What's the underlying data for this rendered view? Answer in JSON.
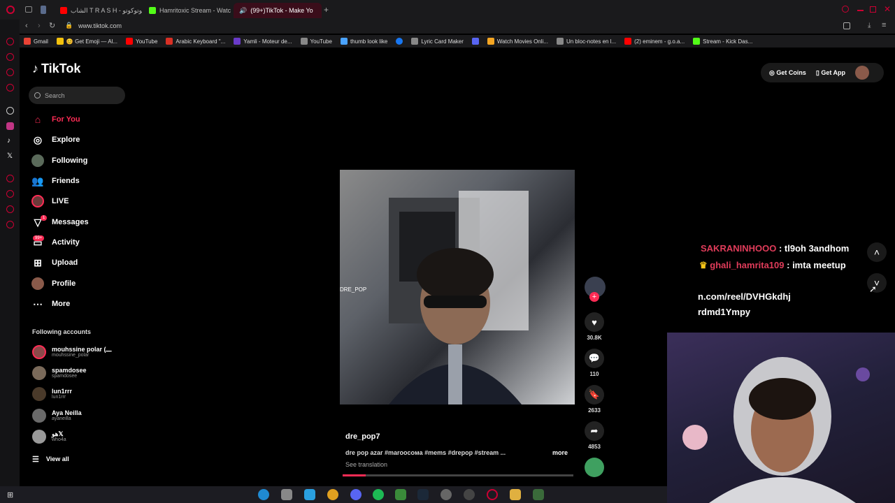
{
  "browser": {
    "tabs": [
      {
        "label": "الشاب T R A S H - كوتوكوتو",
        "color": "#ff0000"
      },
      {
        "label": "Hamritoxic Stream - Watc",
        "color": "#53fc18"
      },
      {
        "label": "(99+)TikTok - Make Yo",
        "color": "#ffffff"
      }
    ],
    "url": "www.tiktok.com",
    "bookmarks": [
      {
        "label": "Gmail",
        "color": "#ea4335"
      },
      {
        "label": "😊 Get Emoji — Al...",
        "color": "#f4c20d"
      },
      {
        "label": "YouTube",
        "color": "#ff0000"
      },
      {
        "label": "Arabic Keyboard \"...",
        "color": "#d93025"
      },
      {
        "label": "Yamli - Moteur de...",
        "color": "#6a3bc9"
      },
      {
        "label": "YouTube",
        "color": "#888888"
      },
      {
        "label": "thumb look like",
        "color": "#4aa3ff"
      },
      {
        "label": "",
        "color": "#1877f2"
      },
      {
        "label": "Lyric Card Maker",
        "color": "#888888"
      },
      {
        "label": "",
        "color": "#5865f2"
      },
      {
        "label": "Watch Movies Onli...",
        "color": "#f5a623"
      },
      {
        "label": "Un bloc-notes en l...",
        "color": "#888888"
      },
      {
        "label": "(2) eminem - g.o.a...",
        "color": "#ff0000"
      },
      {
        "label": "Stream - Kick Das...",
        "color": "#53fc18"
      }
    ]
  },
  "tiktok": {
    "logo": "TikTok",
    "search_placeholder": "Search",
    "nav": [
      {
        "label": "For You",
        "icon": "home-icon"
      },
      {
        "label": "Explore",
        "icon": "compass-icon"
      },
      {
        "label": "Following",
        "icon": "following-avatar-icon"
      },
      {
        "label": "Friends",
        "icon": "friends-icon"
      },
      {
        "label": "LIVE",
        "icon": "live-icon"
      },
      {
        "label": "Messages",
        "icon": "messages-icon",
        "badge": "1"
      },
      {
        "label": "Activity",
        "icon": "activity-icon",
        "badge": "99+"
      },
      {
        "label": "Upload",
        "icon": "upload-icon"
      },
      {
        "label": "Profile",
        "icon": "profile-avatar-icon"
      },
      {
        "label": "More",
        "icon": "more-icon"
      }
    ],
    "following_title": "Following accounts",
    "accounts": [
      {
        "name": "mouhssine polar (ـــ",
        "user": "mouhssine_polar"
      },
      {
        "name": "spamdosee",
        "user": "spamdosee"
      },
      {
        "name": "lun1rrr",
        "user": "lun1rrr"
      },
      {
        "name": "Aya Neilla",
        "user": "ayaneilla"
      },
      {
        "name": "هو𝕏",
        "user": "who4a"
      }
    ],
    "view_all": "View all",
    "get_coins": "Get Coins",
    "get_app": "Get App",
    "video": {
      "author": "dre_pop7",
      "description": "dre pop azar #maroocoма #mems #drepop #stream ...",
      "more": "more",
      "see_translation": "See translation",
      "watermark": "DRE_POP",
      "likes": "30.8K",
      "comments": "110",
      "saves": "2633",
      "shares": "4853",
      "progress": 0.1
    }
  },
  "overlay": {
    "chat": [
      {
        "user": "SAKRANINHOOO",
        "msg": ": tl9oh 3andhom",
        "color": "#e03c5a"
      },
      {
        "user": "ghali_hamrita109",
        "msg": ": imta meetup",
        "color": "#e03c5a"
      }
    ],
    "link_line1": "n.com/reel/DVHGkdhj",
    "link_line2": "rdmd1Ympy"
  }
}
